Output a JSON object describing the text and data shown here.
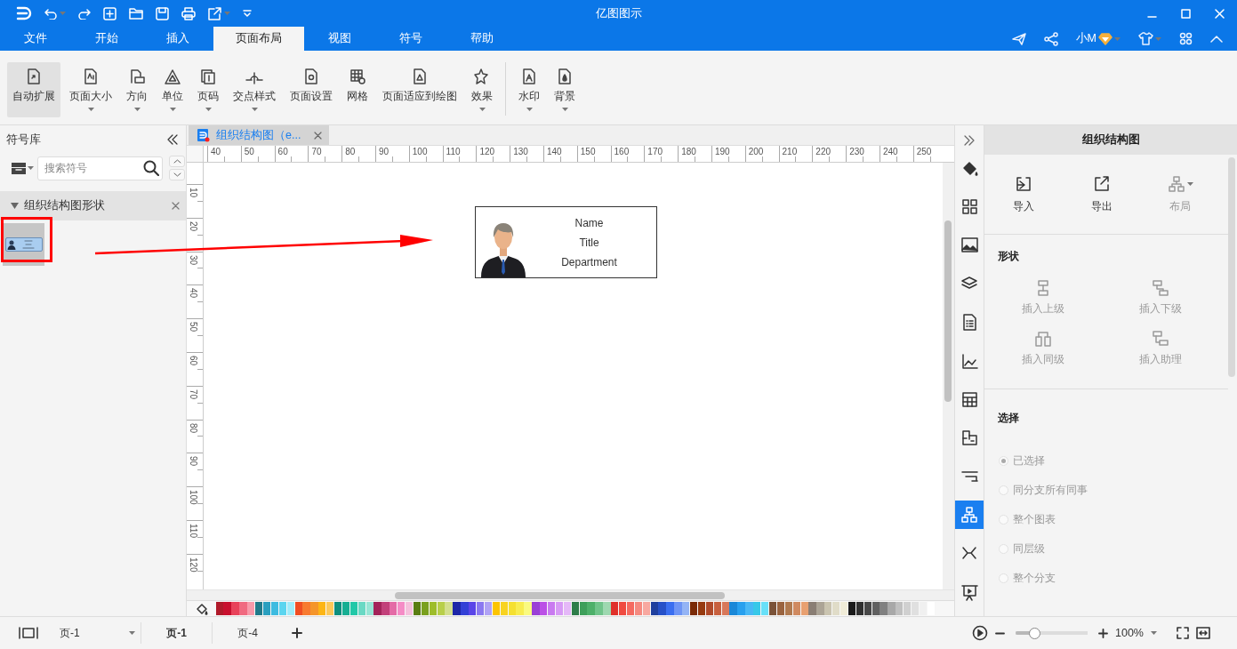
{
  "window": {
    "title": "亿图图示"
  },
  "menu_tabs": [
    {
      "label": "文件",
      "selected": false
    },
    {
      "label": "开始",
      "selected": false
    },
    {
      "label": "插入",
      "selected": false
    },
    {
      "label": "页面布局",
      "selected": true
    },
    {
      "label": "视图",
      "selected": false
    },
    {
      "label": "符号",
      "selected": false
    },
    {
      "label": "帮助",
      "selected": false
    }
  ],
  "user": {
    "name": "小M"
  },
  "ribbon": [
    {
      "label": "自动扩展",
      "selected": true,
      "dropdown": false
    },
    {
      "label": "页面大小",
      "selected": false,
      "dropdown": true
    },
    {
      "label": "方向",
      "selected": false,
      "dropdown": true
    },
    {
      "label": "单位",
      "selected": false,
      "dropdown": true
    },
    {
      "label": "页码",
      "selected": false,
      "dropdown": true
    },
    {
      "label": "交点样式",
      "selected": false,
      "dropdown": true
    },
    {
      "label": "页面设置",
      "selected": false,
      "dropdown": false
    },
    {
      "label": "网格",
      "selected": false,
      "dropdown": false
    },
    {
      "label": "页面适应到绘图",
      "selected": false,
      "dropdown": false
    },
    {
      "label": "效果",
      "selected": false,
      "dropdown": true
    },
    {
      "label": "水印",
      "selected": false,
      "dropdown": true
    },
    {
      "label": "背景",
      "selected": false,
      "dropdown": true
    }
  ],
  "symbol_library": {
    "title": "符号库",
    "search": {
      "placeholder": "搜索符号"
    },
    "category": {
      "title": "组织结构图形状",
      "expanded": true
    }
  },
  "document_tab": {
    "title": "组织结构图（e..."
  },
  "ruler": {
    "horizontal": [
      "40",
      "50",
      "60",
      "70",
      "80",
      "90",
      "100",
      "110",
      "120",
      "130",
      "140",
      "150",
      "160",
      "170",
      "180",
      "190",
      "200",
      "210",
      "220",
      "230",
      "240",
      "250"
    ],
    "vertical": [
      "10",
      "20",
      "30",
      "40",
      "50",
      "60",
      "70",
      "80",
      "90",
      "100",
      "110",
      "120"
    ]
  },
  "org_shape": {
    "name": "Name",
    "title": "Title",
    "department": "Department"
  },
  "palette": [
    {
      "color": "#b01a2a"
    },
    {
      "color": "#c8102e"
    },
    {
      "color": "#e8425a"
    },
    {
      "color": "#f06a80"
    },
    {
      "color": "#f89aaa"
    },
    {
      "color": "#217a8a"
    },
    {
      "color": "#2a9fbf"
    },
    {
      "color": "#3dbbe0"
    },
    {
      "color": "#5bd5ef"
    },
    {
      "color": "#a0ecfa"
    },
    {
      "color": "#f04e23"
    },
    {
      "color": "#f87a30"
    },
    {
      "color": "#f5952a"
    },
    {
      "color": "#fdb515"
    },
    {
      "color": "#fcc85a"
    },
    {
      "color": "#0e8f7e"
    },
    {
      "color": "#17ae92"
    },
    {
      "color": "#21c8a8"
    },
    {
      "color": "#6ad9c4"
    },
    {
      "color": "#98e6d6"
    },
    {
      "color": "#a3245a"
    },
    {
      "color": "#c2407a"
    },
    {
      "color": "#e46aa6"
    },
    {
      "color": "#f58cc6"
    },
    {
      "color": "#f5c0dc"
    },
    {
      "color": "#5a7d12"
    },
    {
      "color": "#7aa01e"
    },
    {
      "color": "#9ebd2a"
    },
    {
      "color": "#b8cf4a"
    },
    {
      "color": "#d3df8e"
    },
    {
      "color": "#1d27a8"
    },
    {
      "color": "#3340d6"
    },
    {
      "color": "#5a45e8"
    },
    {
      "color": "#8a78f0"
    },
    {
      "color": "#b0a2f5"
    },
    {
      "color": "#fcc400"
    },
    {
      "color": "#f8d320"
    },
    {
      "color": "#f5e030"
    },
    {
      "color": "#f8ec50"
    },
    {
      "color": "#fafa80"
    },
    {
      "color": "#9a40d6"
    },
    {
      "color": "#bb50e6"
    },
    {
      "color": "#c97af0"
    },
    {
      "color": "#d79af5"
    },
    {
      "color": "#e5b8f8"
    },
    {
      "color": "#2e7d4a"
    },
    {
      "color": "#3e9f5a"
    },
    {
      "color": "#4eb06a"
    },
    {
      "color": "#70c48a"
    },
    {
      "color": "#9ed8b0"
    },
    {
      "color": "#e0302a"
    },
    {
      "color": "#f04a40"
    },
    {
      "color": "#f56a60"
    },
    {
      "color": "#f58a80"
    },
    {
      "color": "#f8a8a0"
    },
    {
      "color": "#1f3f9e"
    },
    {
      "color": "#2650c8"
    },
    {
      "color": "#3a6ef0"
    },
    {
      "color": "#6e94f5"
    },
    {
      "color": "#94b4f5"
    },
    {
      "color": "#7a2a06"
    },
    {
      "color": "#963a10"
    },
    {
      "color": "#b04a2a"
    },
    {
      "color": "#c8603e"
    },
    {
      "color": "#d8785a"
    },
    {
      "color": "#1a88d8"
    },
    {
      "color": "#28a0ee"
    },
    {
      "color": "#48b8f5"
    },
    {
      "color": "#38c8e8"
    },
    {
      "color": "#68e0f8"
    },
    {
      "color": "#7a5238"
    },
    {
      "color": "#9a6440"
    },
    {
      "color": "#b07a50"
    },
    {
      "color": "#d08a60"
    },
    {
      "color": "#e8a070"
    },
    {
      "color": "#8a7e74"
    },
    {
      "color": "#aca496"
    },
    {
      "color": "#cac4b0"
    },
    {
      "color": "#e0dcc8"
    },
    {
      "color": "#f0ecd8"
    },
    {
      "color": "#1a1a1a"
    },
    {
      "color": "#303030"
    },
    {
      "color": "#484848"
    },
    {
      "color": "#606060"
    },
    {
      "color": "#808080"
    },
    {
      "color": "#a8a8a8"
    },
    {
      "color": "#c0c0c0"
    },
    {
      "color": "#d0d0d0"
    },
    {
      "color": "#e0e0e0"
    },
    {
      "color": "#f0f0f0"
    },
    {
      "color": "#ffffff"
    }
  ],
  "side_toolbar": [
    {
      "selected": false
    },
    {
      "selected": false
    },
    {
      "selected": false
    },
    {
      "selected": false
    },
    {
      "selected": false
    },
    {
      "selected": false
    },
    {
      "selected": false
    },
    {
      "selected": false
    },
    {
      "selected": false
    },
    {
      "selected": true
    },
    {
      "selected": false
    },
    {
      "selected": false
    }
  ],
  "right_panel": {
    "title": "组织结构图",
    "actions": [
      {
        "label": "导入",
        "disabled": false
      },
      {
        "label": "导出",
        "disabled": false
      },
      {
        "label": "布局",
        "disabled": true
      }
    ],
    "shape_section": {
      "title": "形状",
      "actions": [
        {
          "label": "插入上级",
          "disabled": true
        },
        {
          "label": "插入下级",
          "disabled": true
        },
        {
          "label": "插入同级",
          "disabled": true
        },
        {
          "label": "插入助理",
          "disabled": true
        }
      ]
    },
    "select_section": {
      "title": "选择",
      "options": [
        {
          "label": "已选择",
          "selected": true,
          "disabled": true
        },
        {
          "label": "同分支所有同事",
          "selected": false,
          "disabled": true
        },
        {
          "label": "整个图表",
          "selected": false,
          "disabled": true
        },
        {
          "label": "同层级",
          "selected": false,
          "disabled": true
        },
        {
          "label": "整个分支",
          "selected": false,
          "disabled": true
        }
      ]
    }
  },
  "status_bar": {
    "page_select": "页-1",
    "pages": [
      {
        "label": "页-1",
        "selected": true
      },
      {
        "label": "页-4",
        "selected": false
      }
    ],
    "zoom": {
      "level": 0.26,
      "reading": "100%"
    }
  }
}
